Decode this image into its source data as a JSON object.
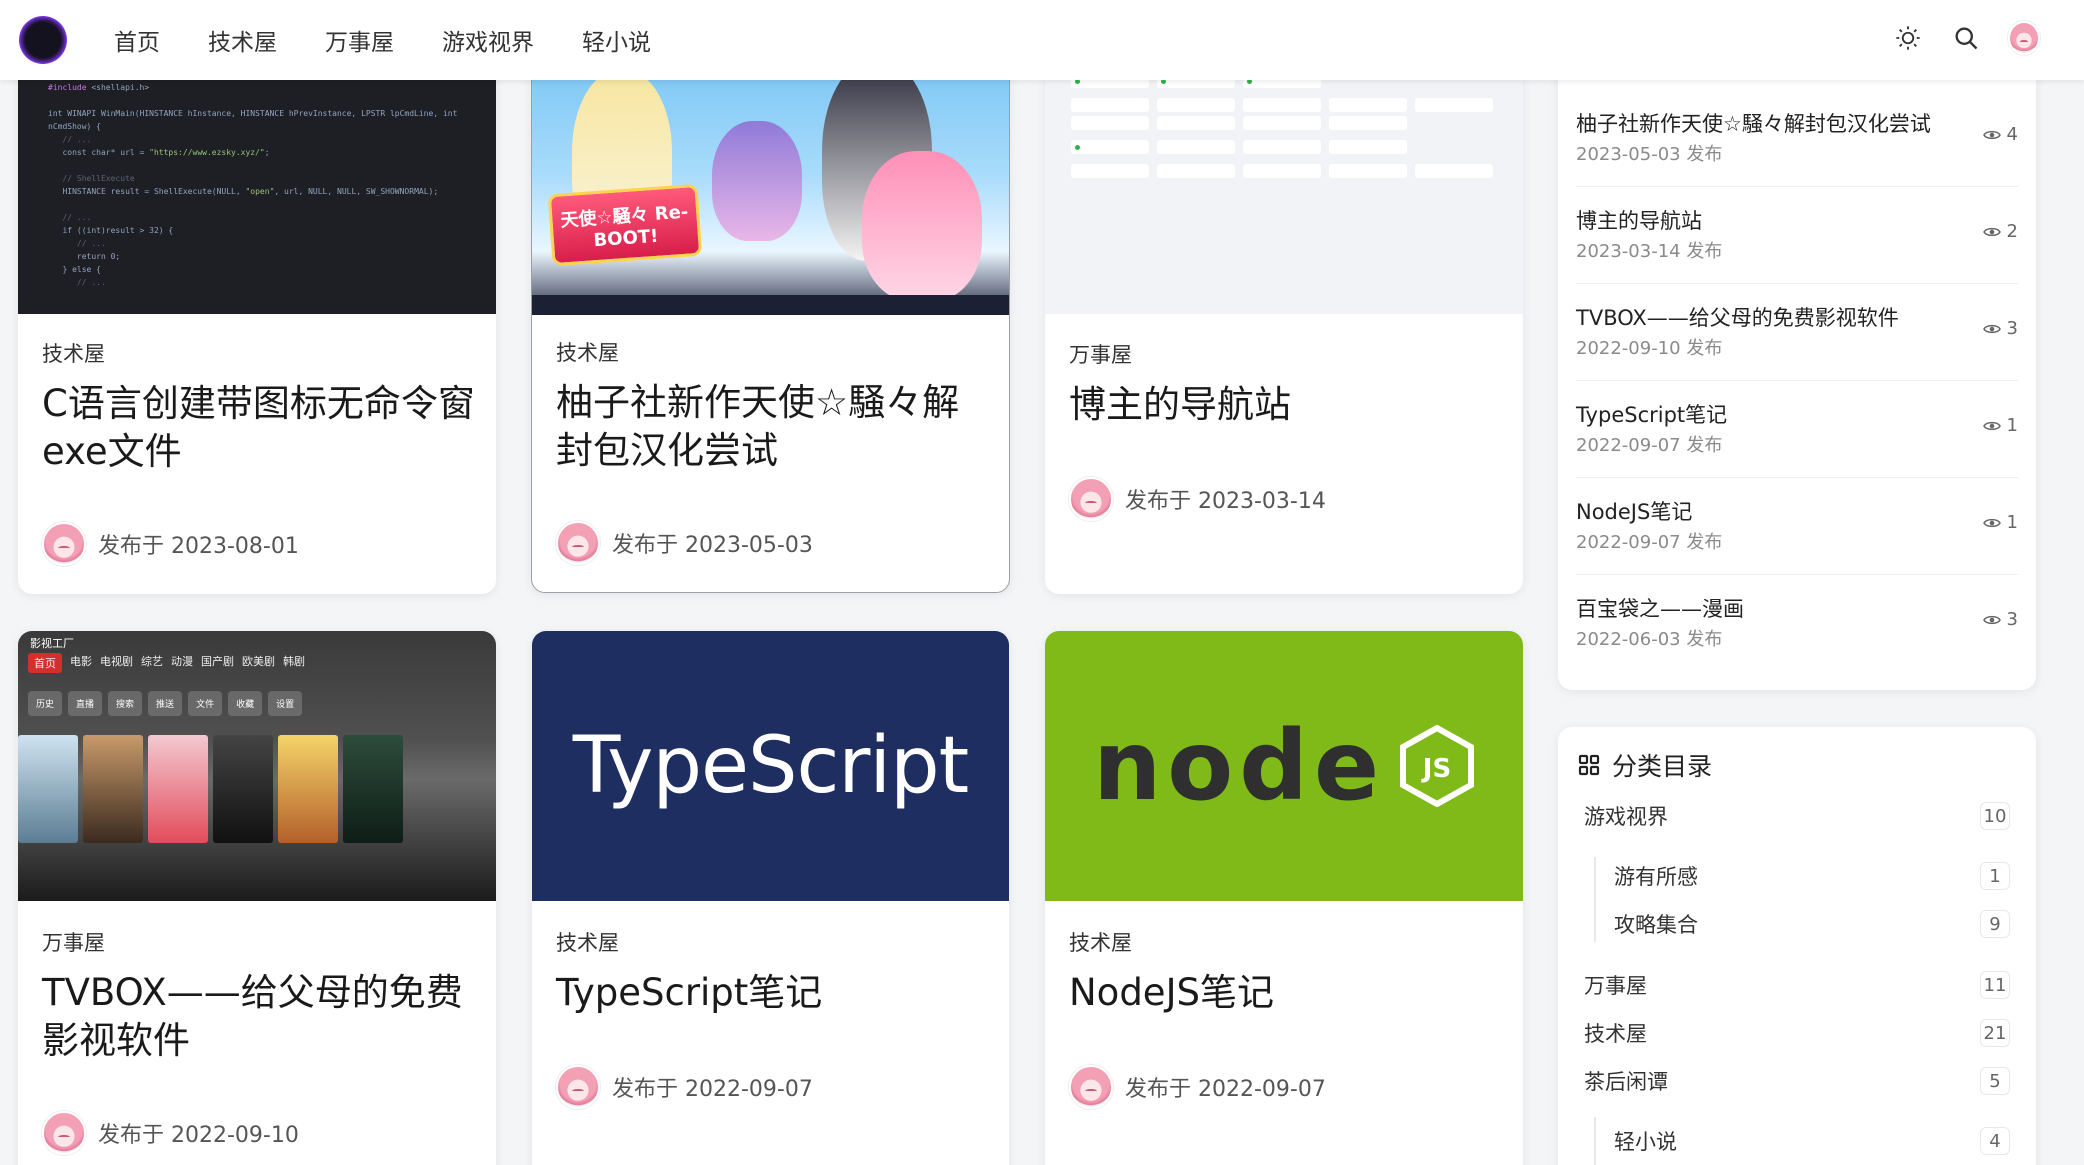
{
  "nav": {
    "home": "首页",
    "tech": "技术屋",
    "misc": "万事屋",
    "games": "游戏视界",
    "novel": "轻小说"
  },
  "header_icons": [
    "sun-icon",
    "search-icon",
    "avatar"
  ],
  "cards": [
    {
      "category": "技术屋",
      "title": "C语言创建带图标无命令窗exe文件",
      "date": "发布于 2023-08-01"
    },
    {
      "category": "技术屋",
      "title": "柚子社新作天使☆騒々解封包汉化尝试",
      "date": "发布于 2023-05-03"
    },
    {
      "category": "万事屋",
      "title": "博主的导航站",
      "date": "发布于 2023-03-14"
    },
    {
      "category": "万事屋",
      "title": "TVBOX——给父母的免费影视软件",
      "date": "发布于 2022-09-10"
    },
    {
      "category": "技术屋",
      "title": "TypeScript笔记",
      "date": "发布于 2022-09-07"
    },
    {
      "category": "技术屋",
      "title": "NodeJS笔记",
      "date": "发布于 2022-09-07"
    }
  ],
  "thumbs": {
    "anime_logo": "天使☆騒々 Re-BOOT!",
    "tv_app": "影视工厂",
    "tv_tabs": [
      "首页",
      "电影",
      "电视剧",
      "综艺",
      "动漫",
      "国产剧",
      "欧美剧",
      "韩剧"
    ],
    "tv_buttons": [
      "历史",
      "直播",
      "搜索",
      "推送",
      "文件",
      "收藏",
      "设置"
    ],
    "typescript": "TypeScript",
    "node": "node"
  },
  "hot_posts": [
    {
      "title": "柚子社新作天使☆騒々解封包汉化尝试",
      "date": "2023-05-03 发布",
      "views": "4"
    },
    {
      "title": "博主的导航站",
      "date": "2023-03-14 发布",
      "views": "2"
    },
    {
      "title": "TVBOX——给父母的免费影视软件",
      "date": "2022-09-10 发布",
      "views": "3"
    },
    {
      "title": "TypeScript笔记",
      "date": "2022-09-07 发布",
      "views": "1"
    },
    {
      "title": "NodeJS笔记",
      "date": "2022-09-07 发布",
      "views": "1"
    },
    {
      "title": "百宝袋之——漫画",
      "date": "2022-06-03 发布",
      "views": "3"
    }
  ],
  "categories": {
    "heading": "分类目录",
    "items": [
      {
        "name": "游戏视界",
        "count": "10"
      },
      {
        "name": "游有所感",
        "count": "1"
      },
      {
        "name": "攻略集合",
        "count": "9"
      },
      {
        "name": "万事屋",
        "count": "11"
      },
      {
        "name": "技术屋",
        "count": "21"
      },
      {
        "name": "茶后闲谭",
        "count": "5"
      },
      {
        "name": "轻小说",
        "count": "4"
      }
    ]
  },
  "colors": {
    "ts_bg": "#1e2e60",
    "node_bg": "#7fba18",
    "accent": "#8a3cff"
  }
}
